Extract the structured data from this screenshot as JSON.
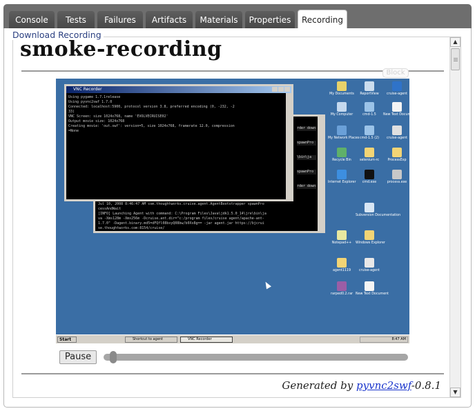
{
  "tabs": [
    {
      "id": "console",
      "label": "Console",
      "active": false
    },
    {
      "id": "tests",
      "label": "Tests",
      "active": false
    },
    {
      "id": "failures",
      "label": "Failures",
      "active": false
    },
    {
      "id": "artifacts",
      "label": "Artifacts",
      "active": false
    },
    {
      "id": "materials",
      "label": "Materials",
      "active": false
    },
    {
      "id": "properties",
      "label": "Properties",
      "active": false
    },
    {
      "id": "recording",
      "label": "Recording",
      "active": true
    }
  ],
  "download_link": "Download Recording",
  "recording": {
    "title": "smoke-recording",
    "block_label": "Block"
  },
  "player": {
    "pause_label": "Pause",
    "progress_fraction": 0.02
  },
  "footer": {
    "generated_prefix": "Generated by ",
    "generator_link": "pyvnc2swf",
    "generator_version": "-0.8.1"
  },
  "desktop": {
    "console_title": "VNC Recorder",
    "console_lines": [
      "Using pygame 1.7.1release",
      "Using pyvnc2swf 1.7.0",
      "Connected: localhost:5900, protocol version 3.8, preferred encoding (0, -232, -2",
      "33)",
      "VNC Screen: size 1024x768, name 'EVOLVECRUISE02'",
      "Output movie size: 1024x768",
      "Creating movie: 'out.swf': version=5, size 1024x768, framerate 12.0, compression",
      "=None"
    ],
    "back_lines": [
      "Jul 10, 2008 8:46:47 AM com.thoughtworks.cruise.agent.AgentBootstrapper spawnPro",
      "cessAndWait",
      "[INFO] Launching Agent with command: C:\\Program Files\\Java\\jdk1.5.0_14\\jre\\bin\\ja",
      "va -Xms128m -Xmx256m -Dcruise.ant.dir=\"c:/program files/cruise agent/apache-ant-",
      "1.7.0\" -Dagent.binary.md5=dFQfl08bxyQ08bw/b0Xx8g== -jar agent.jar https://bjcrui",
      "se.thoughtworks.com:8154/cruise/"
    ],
    "side_snips": [
      "rder down",
      "spawnPro",
      "\\bin\\ja",
      "spawnPro",
      "rder down"
    ],
    "icons": [
      {
        "name": "my-documents-icon",
        "label": "My Documents",
        "color": "#e8d26a"
      },
      {
        "name": "report-view-icon",
        "label": "ReportView",
        "color": "#ccddee"
      },
      {
        "name": "cruise-agent-icon",
        "label": "cruise-agent",
        "color": "#2f73c9"
      },
      {
        "name": "my-computer-icon",
        "label": "My Computer",
        "color": "#c4d8ee"
      },
      {
        "name": "shortcut-icon-1",
        "label": "cmd-1.5",
        "color": "#9bc3e8"
      },
      {
        "name": "new-text-icon",
        "label": "New Text Docum",
        "color": "#f4f4f4"
      },
      {
        "name": "my-network-places-icon",
        "label": "My Network Places",
        "color": "#6aa0d8"
      },
      {
        "name": "shortcut-icon-2",
        "label": "cmd-1.5 (2)",
        "color": "#9bc3e8"
      },
      {
        "name": "cruise-agent-icon-2",
        "label": "cruise-agent",
        "color": "#e0e0e0"
      },
      {
        "name": "recycle-bin-icon",
        "label": "Recycle Bin",
        "color": "#5fb06a"
      },
      {
        "name": "folder-icon-1",
        "label": "selenium-rc",
        "color": "#f2d475"
      },
      {
        "name": "folder-icon-2",
        "label": "ProcessExp",
        "color": "#f2d475"
      },
      {
        "name": "internet-explorer-icon",
        "label": "Internet Explorer",
        "color": "#3d8fe0"
      },
      {
        "name": "cmd-icon",
        "label": "cmd.exe",
        "color": "#111111"
      },
      {
        "name": "process-icon",
        "label": "process.exe",
        "color": "#c8c8c8"
      },
      {
        "name": "subversion-doc-icon",
        "label": "Subversion Documentation",
        "color": "#d8e6f4"
      },
      {
        "name": "notepad-icon",
        "label": "Notepad++",
        "color": "#e8e8a0"
      },
      {
        "name": "windows-explorer-icon",
        "label": "Windows Explorer",
        "color": "#f2d475"
      },
      {
        "name": "folder-icon-3",
        "label": "agent1119",
        "color": "#f2d475"
      },
      {
        "name": "doc-icon",
        "label": "cruise-agent",
        "color": "#e8e8e8"
      },
      {
        "name": "rarped-icon",
        "label": "rarped0.2.rar",
        "color": "#9b5ea6"
      },
      {
        "name": "new-text-icon-2",
        "label": "New Text Document",
        "color": "#f4f4f4"
      }
    ],
    "taskbar": {
      "start": "Start",
      "items": [
        "Shortcut to agent",
        "VNC Recorder"
      ],
      "clock": "8:47 AM"
    }
  }
}
